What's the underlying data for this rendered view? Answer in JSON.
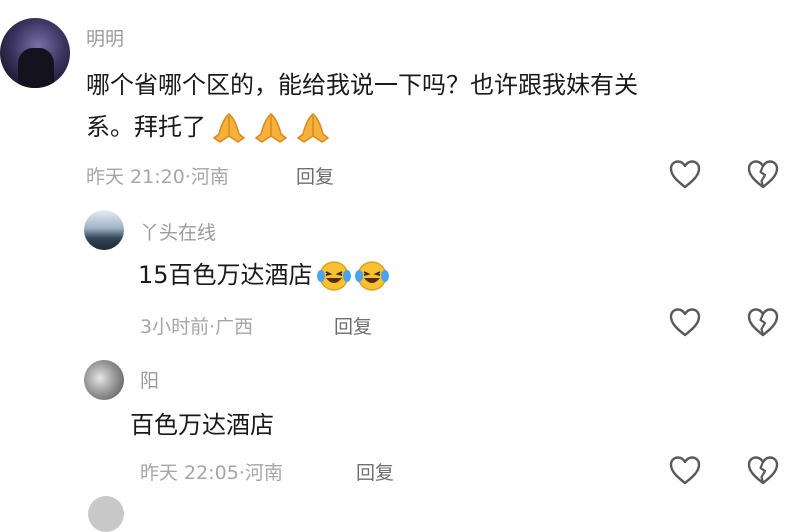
{
  "comments": [
    {
      "username": "明明",
      "text_line1": "哪个省哪个区的，能给我说一下吗？也许跟我妹有关",
      "text_line2": "系。拜托了",
      "emoji": "pray-emoji",
      "emoji_count": 3,
      "time": "昨天 21:20",
      "location": "河南",
      "reply_label": "回复"
    },
    {
      "username": "丫头在线",
      "text": "15百色万达酒店",
      "emoji": "laughing-tears-emoji",
      "emoji_count": 2,
      "time": "3小时前",
      "location": "广西",
      "reply_label": "回复"
    },
    {
      "username": "阳",
      "text": "百色万达酒店",
      "time": "昨天 22:05",
      "location": "河南",
      "reply_label": "回复"
    }
  ],
  "icons": {
    "like": "heart-outline-icon",
    "dislike": "broken-heart-icon"
  },
  "meta_separator": "·"
}
